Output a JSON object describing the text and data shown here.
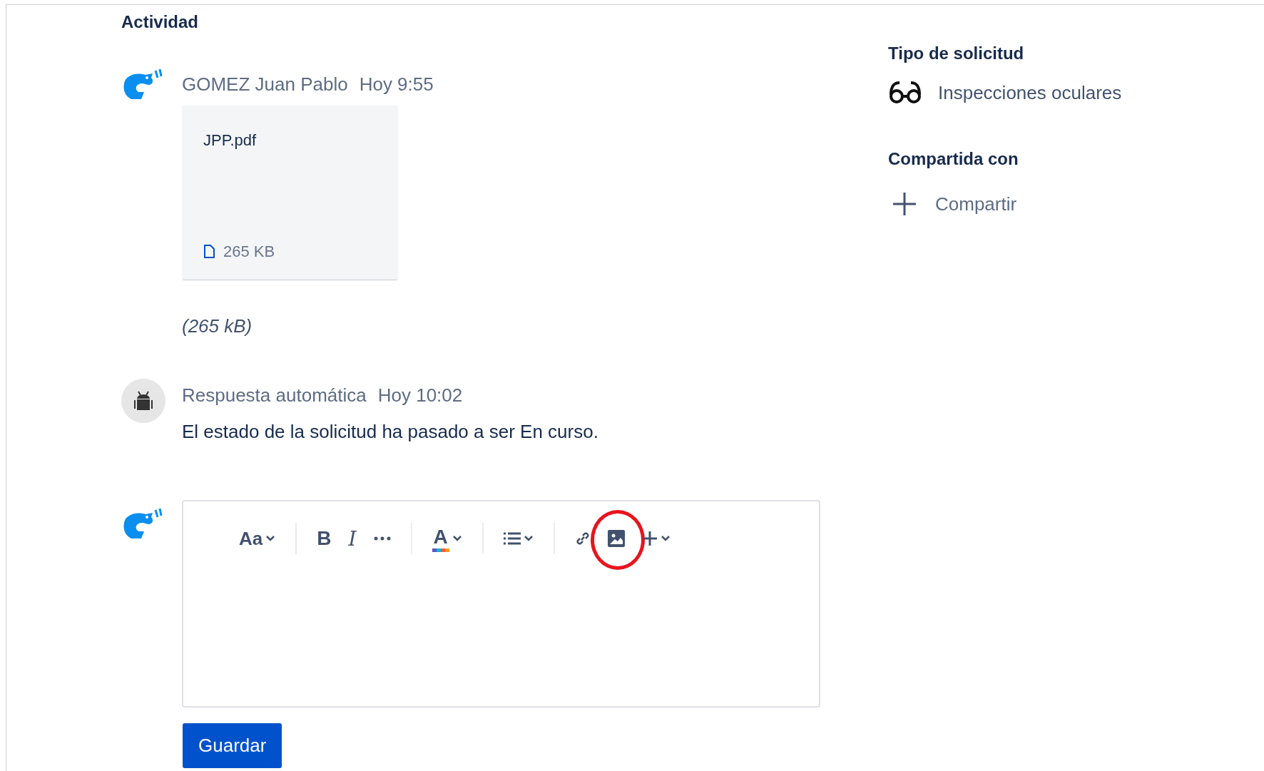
{
  "section_title": "Actividad",
  "comments": [
    {
      "kind": "attachment",
      "avatar": {
        "kind": "fish"
      },
      "author": "GOMEZ Juan Pablo",
      "time": "Hoy 9:55",
      "attachment": {
        "file_name": "JPP.pdf",
        "size": "265 KB"
      },
      "note": "(265 kB)"
    },
    {
      "kind": "message",
      "avatar": {
        "kind": "robot"
      },
      "author": "Respuesta automática",
      "time": "Hoy 10:02",
      "body": "El estado de la solicitud ha pasado a ser En curso."
    }
  ],
  "editor": {
    "avatar": {
      "kind": "fish"
    },
    "toolbar": [
      [
        {
          "kind": "text_style",
          "label": "Aa",
          "caret": true,
          "highlighted": false
        }
      ],
      [
        {
          "kind": "bold",
          "label": "B",
          "caret": false,
          "highlighted": false
        },
        {
          "kind": "italic",
          "label": "I",
          "caret": false,
          "highlighted": false
        },
        {
          "kind": "more",
          "caret": false,
          "highlighted": false
        }
      ],
      [
        {
          "kind": "text_color",
          "label": "A",
          "caret": true,
          "highlighted": false
        }
      ],
      [
        {
          "kind": "list",
          "caret": true,
          "highlighted": false
        }
      ],
      [
        {
          "kind": "link",
          "caret": false,
          "highlighted": false
        },
        {
          "kind": "image",
          "caret": false,
          "highlighted": true
        },
        {
          "kind": "insert",
          "caret": true,
          "highlighted": false
        }
      ]
    ],
    "save_button": "Guardar"
  },
  "side": {
    "request_type": {
      "heading": "Tipo de solicitud",
      "value": "Inspecciones oculares"
    },
    "shared": {
      "heading": "Compartida con",
      "action": "Compartir"
    }
  }
}
